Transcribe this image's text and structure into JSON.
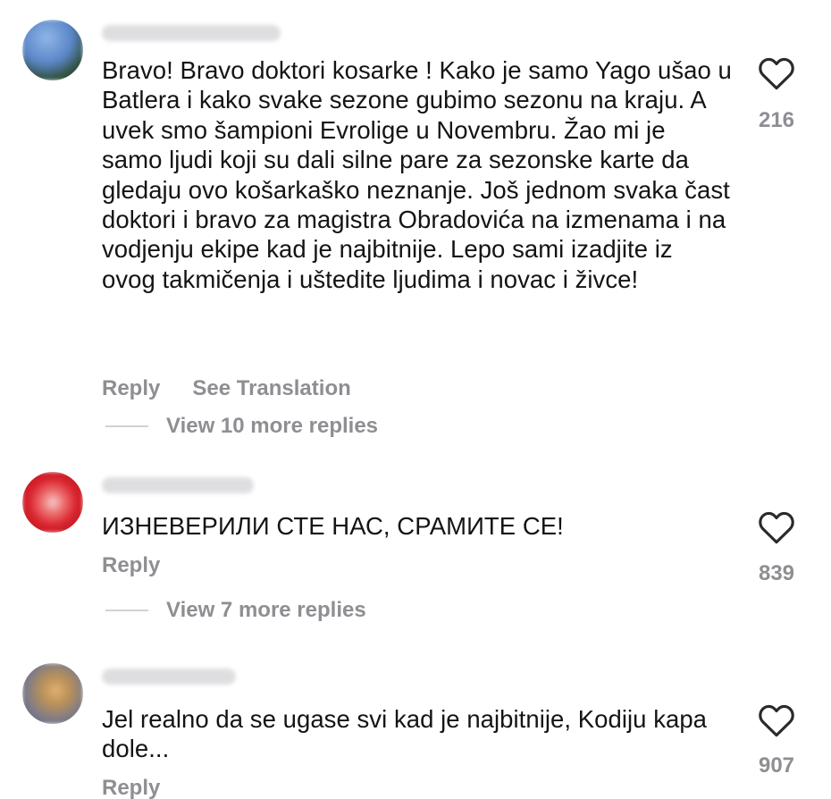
{
  "comments": [
    {
      "text": "Bravo! Bravo doktori kosarke ! Kako je samo Yago ušao u Batlera i kako svake sezone gubimo sezonu na kraju. A uvek smo šampioni Evrolige u Novembru. Žao mi je samo ljudi koji su dali silne pare za sezonske karte da gledaju ovo košarkaško neznanje. Još jednom svaka čast doktori i bravo za magistra Obradovića na izmenama i na vodjenju ekipe kad je najbitnije. Lepo sami izadjite iz ovog takmičenja i uštedite ljudima i novac i živce!",
      "likes": "216",
      "reply_label": "Reply",
      "translate_label": "See Translation",
      "view_replies": "View 10 more replies"
    },
    {
      "text": "ИЗНЕВЕРИЛИ СТЕ НАС, СРАМИТЕ СЕ!",
      "likes": "839",
      "reply_label": "Reply",
      "view_replies": "View 7 more replies"
    },
    {
      "text": "Jel realno da se ugase svi kad je najbitnije, Kodiju kapa dole...",
      "likes": "907",
      "reply_label": "Reply"
    }
  ],
  "colors": {
    "text": "#141414",
    "secondary": "#8e8e93",
    "avatar1": "#5b86c8",
    "avatar2": "#d9242e",
    "avatar3": "#7a7a8a"
  },
  "icons": {
    "like": "heart-outline-icon"
  }
}
